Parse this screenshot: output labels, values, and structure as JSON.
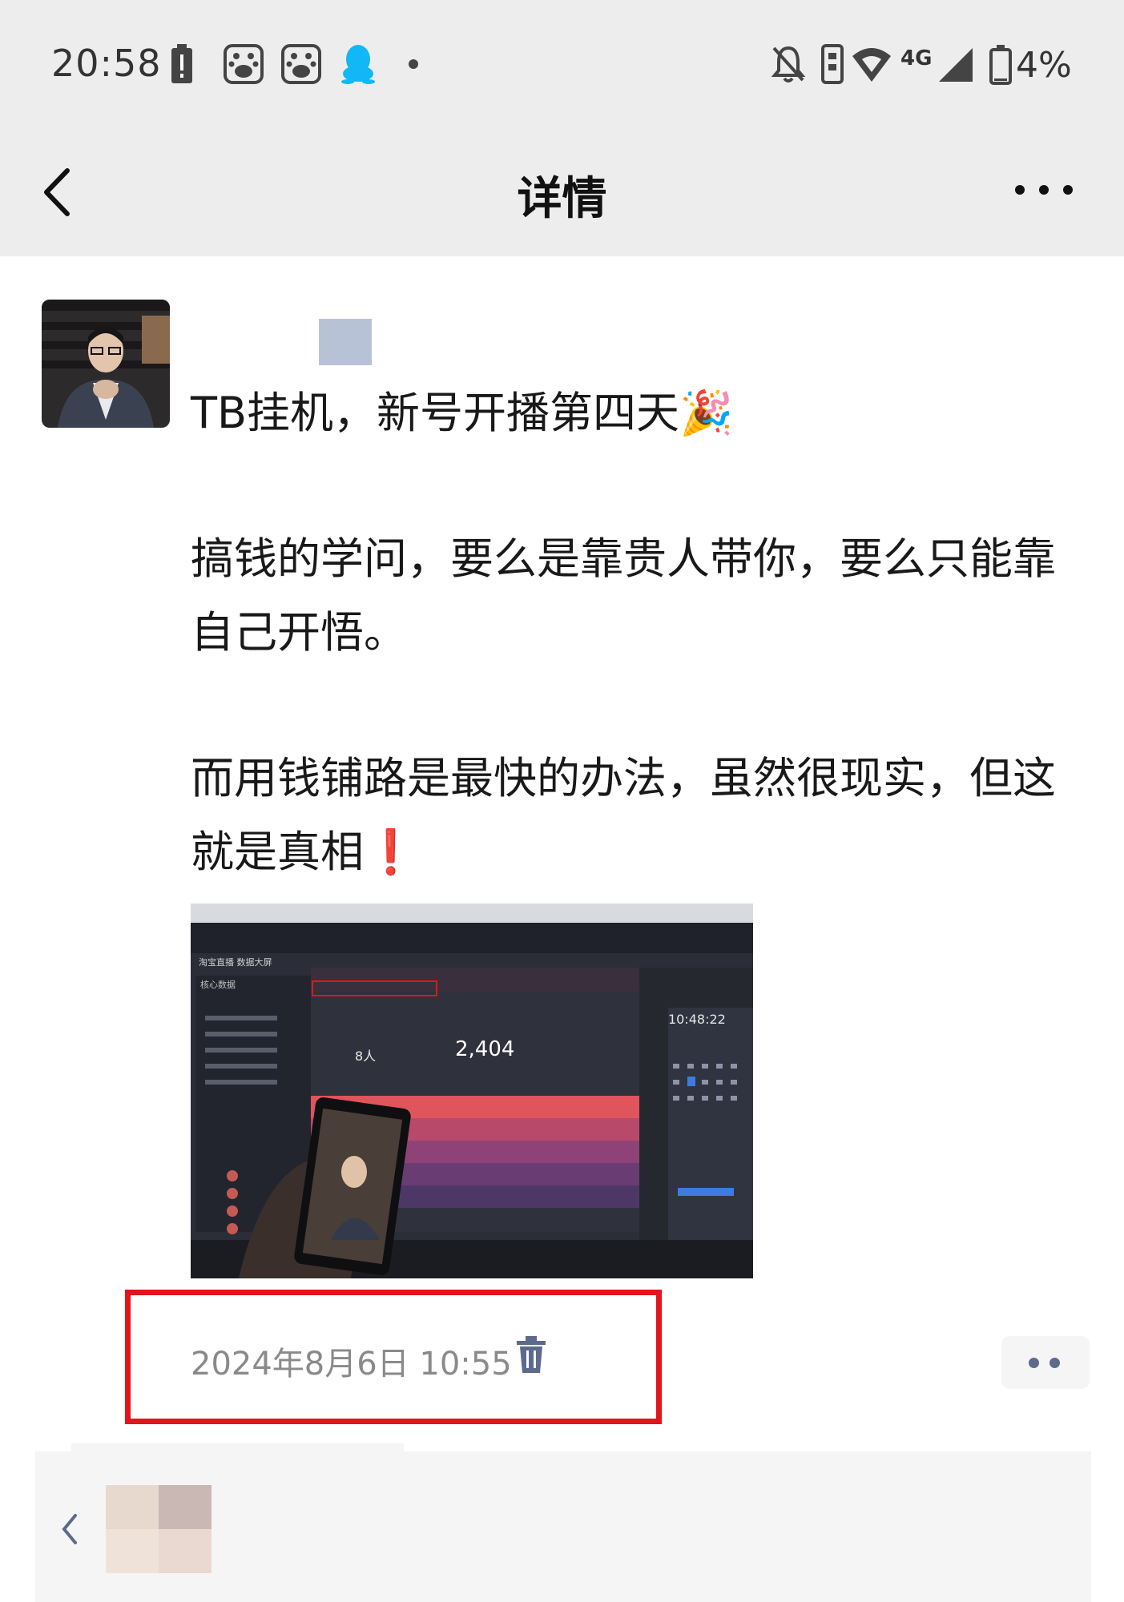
{
  "status_bar": {
    "time": "20:58",
    "network": "4G",
    "battery": "4%",
    "icons": [
      "alert-battery-icon",
      "baidu-icon",
      "baidu-icon",
      "qq-icon",
      "dot-icon",
      "mute-bell-icon",
      "vibrate-icon",
      "wifi-icon",
      "signal-icon",
      "battery-icon"
    ]
  },
  "nav": {
    "title": "详情",
    "back_icon": "back-chevron-icon",
    "more_icon": "more-dots-icon"
  },
  "post": {
    "lines": [
      "TB挂机，新号开播第四天🎉",
      "搞钱的学问，要么是靠贵人带你，要么只能靠自己开悟。",
      "而用钱铺路是最快的办法，虽然很现实，但这就是真相❗"
    ],
    "timestamp": "2024年8月6日 10:55",
    "delete_icon": "trash-icon",
    "more_icon": "more-dots-icon"
  },
  "photo_screen": {
    "header_left": "淘宝直播  数据大屏",
    "section": "核心数据",
    "viewers_value": "8人",
    "gmv_value": "2,404",
    "clock": "10:48:22"
  },
  "colors": {
    "status_bg": "#ededed",
    "link_blue": "#5c6a8c",
    "highlight_red": "#e3141b",
    "timestamp_gray": "#8a8a8a"
  }
}
